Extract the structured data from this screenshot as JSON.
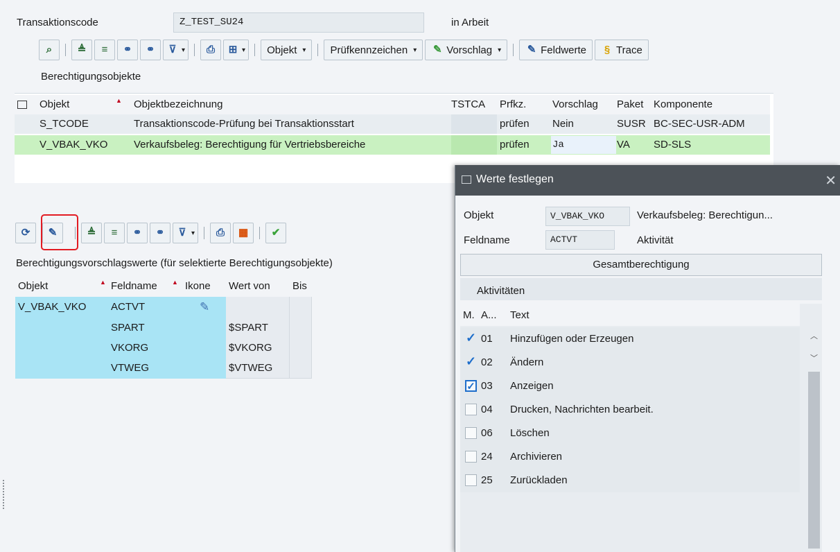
{
  "header": {
    "tcode_label": "Transaktionscode",
    "tcode_value": "Z_TEST_SU24",
    "status": "in Arbeit"
  },
  "toolbar1": {
    "objekt": "Objekt",
    "pruefkennzeichen": "Prüfkennzeichen",
    "vorschlag": "Vorschlag",
    "feldwerte": "Feldwerte",
    "trace": "Trace"
  },
  "objects_section": {
    "title": "Berechtigungsobjekte",
    "columns": [
      "Objekt",
      "Objektbezeichnung",
      "TSTCA",
      "Prfkz.",
      "Vorschlag",
      "Paket",
      "Komponente"
    ],
    "rows": [
      {
        "objekt": "S_TCODE",
        "bez": "Transaktionscode-Prüfung bei Transaktionsstart",
        "tstca": "",
        "prfkz": "prüfen",
        "vorschlag": "Nein",
        "paket": "SUSR",
        "komp": "BC-SEC-USR-ADM"
      },
      {
        "objekt": "V_VBAK_VKO",
        "bez": "Verkaufsbeleg: Berechtigung für Vertriebsbereiche",
        "tstca": "",
        "prfkz": "prüfen",
        "vorschlag": "Ja",
        "paket": "VA",
        "komp": "SD-SLS"
      }
    ]
  },
  "values_section": {
    "title": "Berechtigungsvorschlagswerte (für selektierte Berechtigungsobjekte)",
    "columns": [
      "Objekt",
      "Feldname",
      "Ikone",
      "Wert von",
      "Bis"
    ],
    "objekt": "V_VBAK_VKO",
    "rows": [
      {
        "feld": "ACTVT",
        "wert": ""
      },
      {
        "feld": "SPART",
        "wert": "$SPART"
      },
      {
        "feld": "VKORG",
        "wert": "$VKORG"
      },
      {
        "feld": "VTWEG",
        "wert": "$VTWEG"
      }
    ]
  },
  "dialog": {
    "title": "Werte festlegen",
    "objekt_label": "Objekt",
    "objekt_value": "V_VBAK_VKO",
    "objekt_text": "Verkaufsbeleg: Berechtigun...",
    "feldname_label": "Feldname",
    "feldname_value": "ACTVT",
    "feldname_text": "Aktivität",
    "gesamt": "Gesamtberechtigung",
    "aktivitaeten": "Aktivitäten",
    "col_m": "M.",
    "col_a": "A...",
    "col_text": "Text",
    "items": [
      {
        "code": "01",
        "text": "Hinzufügen oder Erzeugen",
        "checked": true
      },
      {
        "code": "02",
        "text": "Ändern",
        "checked": true
      },
      {
        "code": "03",
        "text": "Anzeigen",
        "checked": true
      },
      {
        "code": "04",
        "text": "Drucken, Nachrichten bearbeit.",
        "checked": false
      },
      {
        "code": "06",
        "text": "Löschen",
        "checked": false
      },
      {
        "code": "24",
        "text": "Archivieren",
        "checked": false
      },
      {
        "code": "25",
        "text": "Zurückladen",
        "checked": false
      }
    ]
  }
}
